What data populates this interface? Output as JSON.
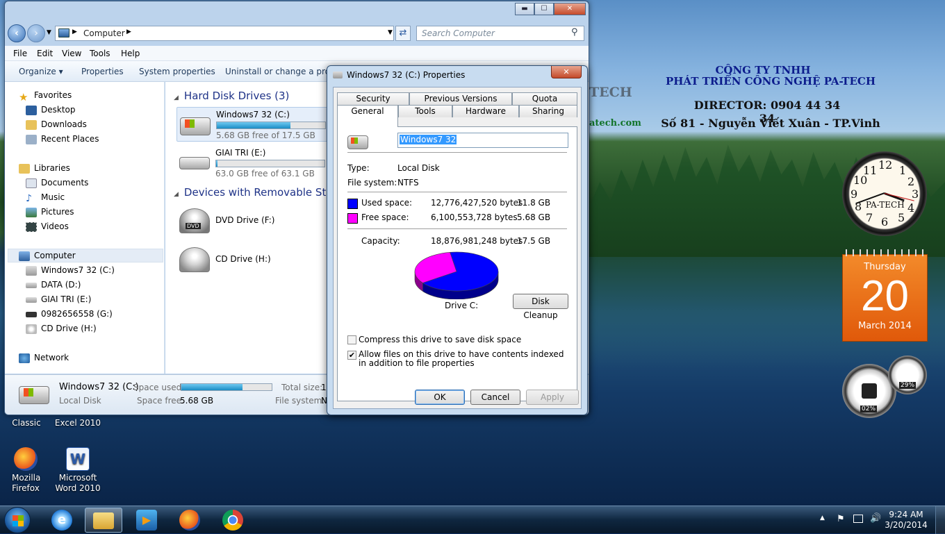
{
  "desktop": {
    "company_lines": [
      "CÔNG TY TNHH",
      "PHÁT TRIỂN CÔNG NGHỆ PA-TECH",
      "DIRECTOR: 0904 44 34 34",
      "Số 81 - Nguyễn Viết Xuân - TP.Vinh"
    ],
    "behind_fragments": {
      "logo_text": "TECH",
      "web_text": "atech.com"
    },
    "icons": [
      {
        "label": "Classic",
        "icon": "classic-shell-icon"
      },
      {
        "label": "Excel 2010",
        "icon": "excel-icon"
      },
      {
        "label": "Mozilla Firefox",
        "icon": "firefox-icon"
      },
      {
        "label": "Microsoft Word 2010",
        "icon": "word-icon"
      }
    ]
  },
  "gadgets": {
    "clock": {
      "brand": "PA-TECH",
      "numbers": [
        "12",
        "1",
        "2",
        "3",
        "4",
        "5",
        "6",
        "7",
        "8",
        "9",
        "10",
        "11"
      ]
    },
    "calendar": {
      "weekday": "Thursday",
      "day": "20",
      "month_year": "March 2014"
    },
    "meters": {
      "cpu": "02%",
      "memory": "29%"
    }
  },
  "explorer": {
    "window_buttons": {
      "minimize": "▬",
      "maximize": "☐",
      "close": "✕"
    },
    "address": {
      "root_icon": "computer-icon",
      "path": "Computer"
    },
    "search": {
      "placeholder": "Search Computer"
    },
    "menu": [
      "File",
      "Edit",
      "View",
      "Tools",
      "Help"
    ],
    "commands": [
      "Organize ▾",
      "Properties",
      "System properties",
      "Uninstall or change a progra"
    ],
    "nav": {
      "favorites": {
        "title": "Favorites",
        "items": [
          "Desktop",
          "Downloads",
          "Recent Places"
        ]
      },
      "libraries": {
        "title": "Libraries",
        "items": [
          "Documents",
          "Music",
          "Pictures",
          "Videos"
        ]
      },
      "computer": {
        "title": "Computer",
        "items": [
          "Windows7 32 (C:)",
          "DATA (D:)",
          "GIAI TRI (E:)",
          "0982656558 (G:)",
          "CD Drive (H:)"
        ]
      },
      "network": "Network"
    },
    "hard_disk_group": "Hard Disk Drives (3)",
    "drives": [
      {
        "name": "Windows7 32 (C:)",
        "free": "5.68 GB free of 17.5 GB",
        "used_fraction": 0.68
      },
      {
        "name": "GIAI TRI (E:)",
        "free": "63.0 GB free of 63.1 GB",
        "used_fraction": 0.01
      }
    ],
    "removable_group": "Devices with Removable Storag",
    "removable": [
      {
        "name": "DVD Drive (F:)",
        "badge": "DVD"
      },
      {
        "name": "CD Drive (H:)"
      }
    ],
    "details": {
      "name": "Windows7 32 (C:)",
      "type": "Local Disk",
      "space_used_label": "Space used:",
      "space_free_label": "Space free:",
      "space_free": "5.68 GB",
      "total_label": "Total size:",
      "total_value": "1",
      "fs_label": "File system:",
      "fs_value": "N",
      "used_fraction": 0.68
    }
  },
  "properties": {
    "title": "Windows7 32 (C:) Properties",
    "tabs_row1": [
      "Security",
      "Previous Versions",
      "Quota"
    ],
    "tabs_row2": [
      "General",
      "Tools",
      "Hardware",
      "Sharing"
    ],
    "active_tab": "General",
    "drive_label": "Windows7 32",
    "type_label": "Type:",
    "type_value": "Local Disk",
    "fs_label": "File system:",
    "fs_value": "NTFS",
    "used": {
      "label": "Used space:",
      "bytes": "12,776,427,520 bytes",
      "size": "11.8 GB",
      "color": "#0000ff",
      "value_gb": 11.8
    },
    "free": {
      "label": "Free space:",
      "bytes": "6,100,553,728 bytes",
      "size": "5.68 GB",
      "color": "#ff00ff",
      "value_gb": 5.68
    },
    "capacity": {
      "label": "Capacity:",
      "bytes": "18,876,981,248 bytes",
      "size": "17.5 GB"
    },
    "drive_caption": "Drive C:",
    "cleanup_button": "Disk Cleanup",
    "compress_label": "Compress this drive to save disk space",
    "compress_checked": false,
    "index_label": "Allow files on this drive to have contents indexed in addition to file properties",
    "index_checked": true,
    "buttons": {
      "ok": "OK",
      "cancel": "Cancel",
      "apply": "Apply"
    }
  },
  "taskbar": {
    "pinned": [
      "start-orb",
      "internet-explorer-icon",
      "windows-explorer-icon",
      "media-player-icon",
      "firefox-icon",
      "chrome-icon"
    ],
    "tray": {
      "arrow": "▲",
      "time": "9:24 AM",
      "date": "3/20/2014"
    }
  }
}
